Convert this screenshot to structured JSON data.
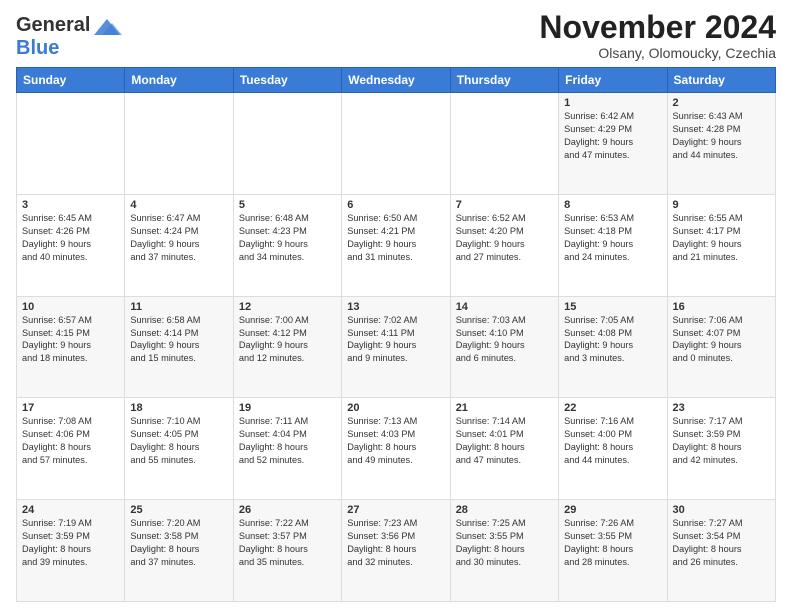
{
  "header": {
    "logo_line1": "General",
    "logo_line2": "Blue",
    "month": "November 2024",
    "location": "Olsany, Olomoucky, Czechia"
  },
  "days_of_week": [
    "Sunday",
    "Monday",
    "Tuesday",
    "Wednesday",
    "Thursday",
    "Friday",
    "Saturday"
  ],
  "weeks": [
    [
      {
        "day": "",
        "info": ""
      },
      {
        "day": "",
        "info": ""
      },
      {
        "day": "",
        "info": ""
      },
      {
        "day": "",
        "info": ""
      },
      {
        "day": "",
        "info": ""
      },
      {
        "day": "1",
        "info": "Sunrise: 6:42 AM\nSunset: 4:29 PM\nDaylight: 9 hours\nand 47 minutes."
      },
      {
        "day": "2",
        "info": "Sunrise: 6:43 AM\nSunset: 4:28 PM\nDaylight: 9 hours\nand 44 minutes."
      }
    ],
    [
      {
        "day": "3",
        "info": "Sunrise: 6:45 AM\nSunset: 4:26 PM\nDaylight: 9 hours\nand 40 minutes."
      },
      {
        "day": "4",
        "info": "Sunrise: 6:47 AM\nSunset: 4:24 PM\nDaylight: 9 hours\nand 37 minutes."
      },
      {
        "day": "5",
        "info": "Sunrise: 6:48 AM\nSunset: 4:23 PM\nDaylight: 9 hours\nand 34 minutes."
      },
      {
        "day": "6",
        "info": "Sunrise: 6:50 AM\nSunset: 4:21 PM\nDaylight: 9 hours\nand 31 minutes."
      },
      {
        "day": "7",
        "info": "Sunrise: 6:52 AM\nSunset: 4:20 PM\nDaylight: 9 hours\nand 27 minutes."
      },
      {
        "day": "8",
        "info": "Sunrise: 6:53 AM\nSunset: 4:18 PM\nDaylight: 9 hours\nand 24 minutes."
      },
      {
        "day": "9",
        "info": "Sunrise: 6:55 AM\nSunset: 4:17 PM\nDaylight: 9 hours\nand 21 minutes."
      }
    ],
    [
      {
        "day": "10",
        "info": "Sunrise: 6:57 AM\nSunset: 4:15 PM\nDaylight: 9 hours\nand 18 minutes."
      },
      {
        "day": "11",
        "info": "Sunrise: 6:58 AM\nSunset: 4:14 PM\nDaylight: 9 hours\nand 15 minutes."
      },
      {
        "day": "12",
        "info": "Sunrise: 7:00 AM\nSunset: 4:12 PM\nDaylight: 9 hours\nand 12 minutes."
      },
      {
        "day": "13",
        "info": "Sunrise: 7:02 AM\nSunset: 4:11 PM\nDaylight: 9 hours\nand 9 minutes."
      },
      {
        "day": "14",
        "info": "Sunrise: 7:03 AM\nSunset: 4:10 PM\nDaylight: 9 hours\nand 6 minutes."
      },
      {
        "day": "15",
        "info": "Sunrise: 7:05 AM\nSunset: 4:08 PM\nDaylight: 9 hours\nand 3 minutes."
      },
      {
        "day": "16",
        "info": "Sunrise: 7:06 AM\nSunset: 4:07 PM\nDaylight: 9 hours\nand 0 minutes."
      }
    ],
    [
      {
        "day": "17",
        "info": "Sunrise: 7:08 AM\nSunset: 4:06 PM\nDaylight: 8 hours\nand 57 minutes."
      },
      {
        "day": "18",
        "info": "Sunrise: 7:10 AM\nSunset: 4:05 PM\nDaylight: 8 hours\nand 55 minutes."
      },
      {
        "day": "19",
        "info": "Sunrise: 7:11 AM\nSunset: 4:04 PM\nDaylight: 8 hours\nand 52 minutes."
      },
      {
        "day": "20",
        "info": "Sunrise: 7:13 AM\nSunset: 4:03 PM\nDaylight: 8 hours\nand 49 minutes."
      },
      {
        "day": "21",
        "info": "Sunrise: 7:14 AM\nSunset: 4:01 PM\nDaylight: 8 hours\nand 47 minutes."
      },
      {
        "day": "22",
        "info": "Sunrise: 7:16 AM\nSunset: 4:00 PM\nDaylight: 8 hours\nand 44 minutes."
      },
      {
        "day": "23",
        "info": "Sunrise: 7:17 AM\nSunset: 3:59 PM\nDaylight: 8 hours\nand 42 minutes."
      }
    ],
    [
      {
        "day": "24",
        "info": "Sunrise: 7:19 AM\nSunset: 3:59 PM\nDaylight: 8 hours\nand 39 minutes."
      },
      {
        "day": "25",
        "info": "Sunrise: 7:20 AM\nSunset: 3:58 PM\nDaylight: 8 hours\nand 37 minutes."
      },
      {
        "day": "26",
        "info": "Sunrise: 7:22 AM\nSunset: 3:57 PM\nDaylight: 8 hours\nand 35 minutes."
      },
      {
        "day": "27",
        "info": "Sunrise: 7:23 AM\nSunset: 3:56 PM\nDaylight: 8 hours\nand 32 minutes."
      },
      {
        "day": "28",
        "info": "Sunrise: 7:25 AM\nSunset: 3:55 PM\nDaylight: 8 hours\nand 30 minutes."
      },
      {
        "day": "29",
        "info": "Sunrise: 7:26 AM\nSunset: 3:55 PM\nDaylight: 8 hours\nand 28 minutes."
      },
      {
        "day": "30",
        "info": "Sunrise: 7:27 AM\nSunset: 3:54 PM\nDaylight: 8 hours\nand 26 minutes."
      }
    ]
  ]
}
